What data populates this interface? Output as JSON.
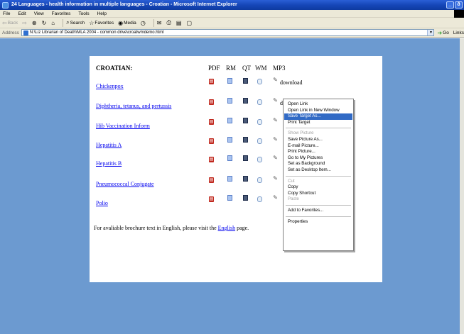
{
  "window": {
    "title": "24 Languages - health information in multiple languages - Croatian - Microsoft Internet Explorer",
    "controls": [
      "_",
      "ð"
    ]
  },
  "menubar": {
    "items": [
      "File",
      "Edit",
      "View",
      "Favorites",
      "Tools",
      "Help"
    ]
  },
  "toolbar": {
    "back": "Back",
    "search": "Search",
    "favorites": "Favorites",
    "media": "Media"
  },
  "addressbar": {
    "label": "Address",
    "value": "N:\\Liz Librarian of Death\\MLA 2004 - common drive\\croatwmdemo.html",
    "go": "Go",
    "links": "Links"
  },
  "page": {
    "language_title": "CROATIAN:",
    "columns": [
      "PDF",
      "RM",
      "QT",
      "WM",
      "MP3"
    ],
    "diseases": [
      "Chickenpox",
      "Diphtheria, tetanus, and pertussis",
      "Hib Vaccination Inform",
      "Hepatitis A",
      "Hepatitis B",
      "Pneumococcal Conjugate",
      "Polio"
    ],
    "download_labels": [
      "download",
      "download"
    ],
    "footer": {
      "before": "For avaliable brochure text in English, please visit the ",
      "link": "English",
      "after": " page."
    }
  },
  "context_menu": {
    "items": [
      "Open Link",
      "Open Link in New Window",
      "Save Target As...",
      "Print Target",
      "Show Picture",
      "Save Picture As...",
      "E-mail Picture...",
      "Print Picture...",
      "Go to My Pictures",
      "Set as Background",
      "Set as Desktop Item...",
      "Cut",
      "Copy",
      "Copy Shortcut",
      "Paste",
      "Add to Favorites...",
      "Properties"
    ]
  },
  "icons": {
    "pdf": "pdf-icon",
    "rm": "realmedia-icon",
    "qt": "quicktime-icon",
    "wm": "windowsmedia-icon",
    "mp3": "mp3-icon"
  },
  "colors": {
    "desktop_blue": "#6c9ad0",
    "link_blue": "#0000ee",
    "highlight": "#316ac5"
  }
}
